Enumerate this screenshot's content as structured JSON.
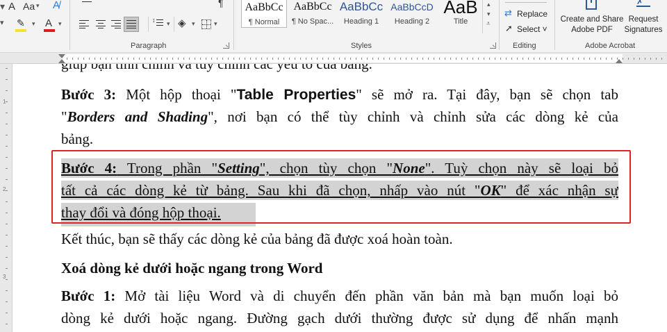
{
  "ribbon": {
    "font_row": {
      "font_size_grow_label": "A",
      "change_case_label": "Aa",
      "font_color_label": "A",
      "highlight_label": "A"
    },
    "paragraph": {
      "group_label": "Paragraph",
      "pilcrow": "¶"
    },
    "styles": {
      "group_label": "Styles",
      "items": [
        {
          "sample": "AaBbCc",
          "name": "¶ Normal",
          "selected": true
        },
        {
          "sample": "AaBbCc",
          "name": "¶ No Spac..."
        },
        {
          "sample": "AaBbCc",
          "name": "Heading 1"
        },
        {
          "sample": "AaBbCcD",
          "name": "Heading 2"
        },
        {
          "sample": "AaB",
          "name": "Title"
        }
      ]
    },
    "editing": {
      "group_label": "Editing",
      "replace_label": "Replace",
      "select_label": "Select ˅"
    },
    "adobe": {
      "group_label": "Adobe Acrobat",
      "create_share_line1": "Create and Share",
      "create_share_line2": "Adobe PDF",
      "request_line1": "Request",
      "request_line2": "Signatures"
    },
    "colors": {
      "highlight_yellow": "#f5e32b",
      "font_red": "#e01b1b",
      "adobe_blue": "#2b579a"
    }
  },
  "vertical_ruler": {
    "labels": [
      "1",
      "2",
      "3"
    ]
  },
  "document": {
    "top_cut_line": "giúp bạn tinh chỉnh và tùy chỉnh các yếu tố của bảng.",
    "step3": {
      "label": "Bước 3:",
      "text_a": " Một hộp thoại \"",
      "bold_a": "Table Properties",
      "text_b": "\" sẽ mở ra. Tại đây, bạn sẽ chọn tab",
      "line2_q1": "\"",
      "bold_italic_b": "Borders and Shading",
      "line2_rest": "\", nơi bạn có thể tùy chỉnh và chỉnh sửa các dòng kẻ của",
      "line3": "bảng."
    },
    "step4": {
      "label": "Bước 4:",
      "text_a": " Trong phần \"",
      "bi_setting": "Setting",
      "text_b": "\", chọn tùy chọn \"",
      "bi_none": "None",
      "text_c": "\". Tuỳ chọn này sẽ loại bỏ",
      "line2_a": "tất cả các dòng kẻ từ bảng. Sau khi đã chọn, nhấp vào nút \"",
      "bi_ok": "OK",
      "line2_b": "\" để xác nhận sự",
      "line3": "thay đổi và đóng hộp thoại."
    },
    "conclusion": "Kết thúc, bạn sẽ thấy các dòng kẻ của bảng đã được xoá hoàn toàn.",
    "heading": "Xoá dòng kẻ dưới hoặc ngang trong Word",
    "step1": {
      "label": "Bước 1:",
      "line1_rest": " Mở tài liệu Word và di chuyển đến phần văn bản mà bạn muốn loại bỏ",
      "line2": "dòng kẻ dưới hoặc ngang. Đường gạch dưới thường được sử dụng để nhấn mạnh"
    },
    "highlight_color": "#d3d3d3",
    "annotation_color": "#d9252a"
  }
}
